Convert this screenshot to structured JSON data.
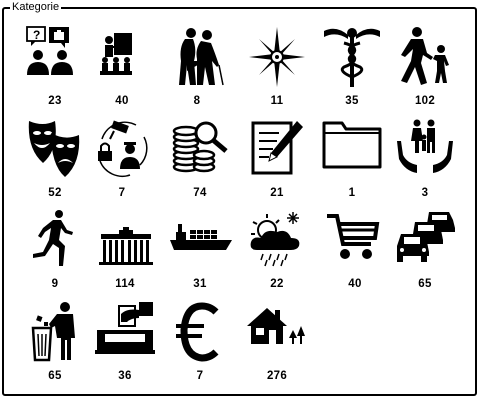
{
  "legend": "Kategorie",
  "categories": [
    {
      "icon": "consultation-icon",
      "count": "23"
    },
    {
      "icon": "presentation-icon",
      "count": "40"
    },
    {
      "icon": "elderly-people-icon",
      "count": "8"
    },
    {
      "icon": "compass-rose-icon",
      "count": "11"
    },
    {
      "icon": "caduceus-icon",
      "count": "35"
    },
    {
      "icon": "parent-child-icon",
      "count": "102"
    },
    {
      "icon": "theater-masks-icon",
      "count": "52"
    },
    {
      "icon": "security-camera-police-icon",
      "count": "7"
    },
    {
      "icon": "coins-magnifier-icon",
      "count": "74"
    },
    {
      "icon": "document-pencil-icon",
      "count": "21"
    },
    {
      "icon": "folder-icon",
      "count": "1"
    },
    {
      "icon": "family-hands-icon",
      "count": "3"
    },
    {
      "icon": "runner-icon",
      "count": "9"
    },
    {
      "icon": "brandenburg-gate-icon",
      "count": "114"
    },
    {
      "icon": "cargo-ship-icon",
      "count": "31"
    },
    {
      "icon": "weather-icon",
      "count": "22"
    },
    {
      "icon": "shopping-cart-icon",
      "count": "40"
    },
    {
      "icon": "traffic-jam-icon",
      "count": "65"
    },
    {
      "icon": "person-waste-bin-icon",
      "count": "65"
    },
    {
      "icon": "ballot-box-icon",
      "count": "36"
    },
    {
      "icon": "euro-icon",
      "count": "7"
    },
    {
      "icon": "house-trees-icon",
      "count": "276"
    }
  ]
}
